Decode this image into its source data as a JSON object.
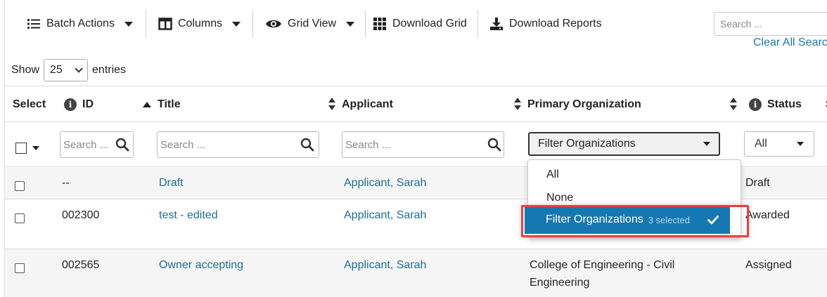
{
  "toolbar": {
    "batch_actions": "Batch Actions",
    "columns": "Columns",
    "grid_view": "Grid View",
    "download_grid": "Download Grid",
    "download_reports": "Download Reports",
    "search_placeholder": "Search ...",
    "clear_all_search": "Clear All Search"
  },
  "entries": {
    "show_label": "Show",
    "value": "25",
    "entries_label": "entries"
  },
  "table": {
    "headers": {
      "select": "Select",
      "id": "ID",
      "title": "Title",
      "applicant": "Applicant",
      "primary_org": "Primary Organization",
      "status": "Status"
    },
    "filters": {
      "id_placeholder": "Search ...",
      "title_placeholder": "Search ...",
      "applicant_placeholder": "Search ...",
      "org_filter_label": "Filter Organizations",
      "status_value": "All"
    },
    "rows": [
      {
        "id": "--",
        "title": "Draft",
        "applicant": "Applicant, Sarah",
        "org_line1": "",
        "org_line2": "",
        "status": "Draft"
      },
      {
        "id": "002300",
        "title": "test - edited",
        "applicant": "Applicant, Sarah",
        "org_line1": "",
        "org_line2": "",
        "status": "Awarded"
      },
      {
        "id": "002565",
        "title": "Owner accepting",
        "applicant": "Applicant, Sarah",
        "org_line1": "College of Engineering - Civil",
        "org_line2": "Engineering",
        "status": "Assigned"
      }
    ]
  },
  "org_dropdown": {
    "options": [
      "All",
      "None"
    ],
    "selected_label": "Filter Organizations",
    "selected_count": "3 selected"
  },
  "colors": {
    "link": "#1a6f99",
    "selected_bg": "#1678b0",
    "highlight": "#e0433f"
  }
}
